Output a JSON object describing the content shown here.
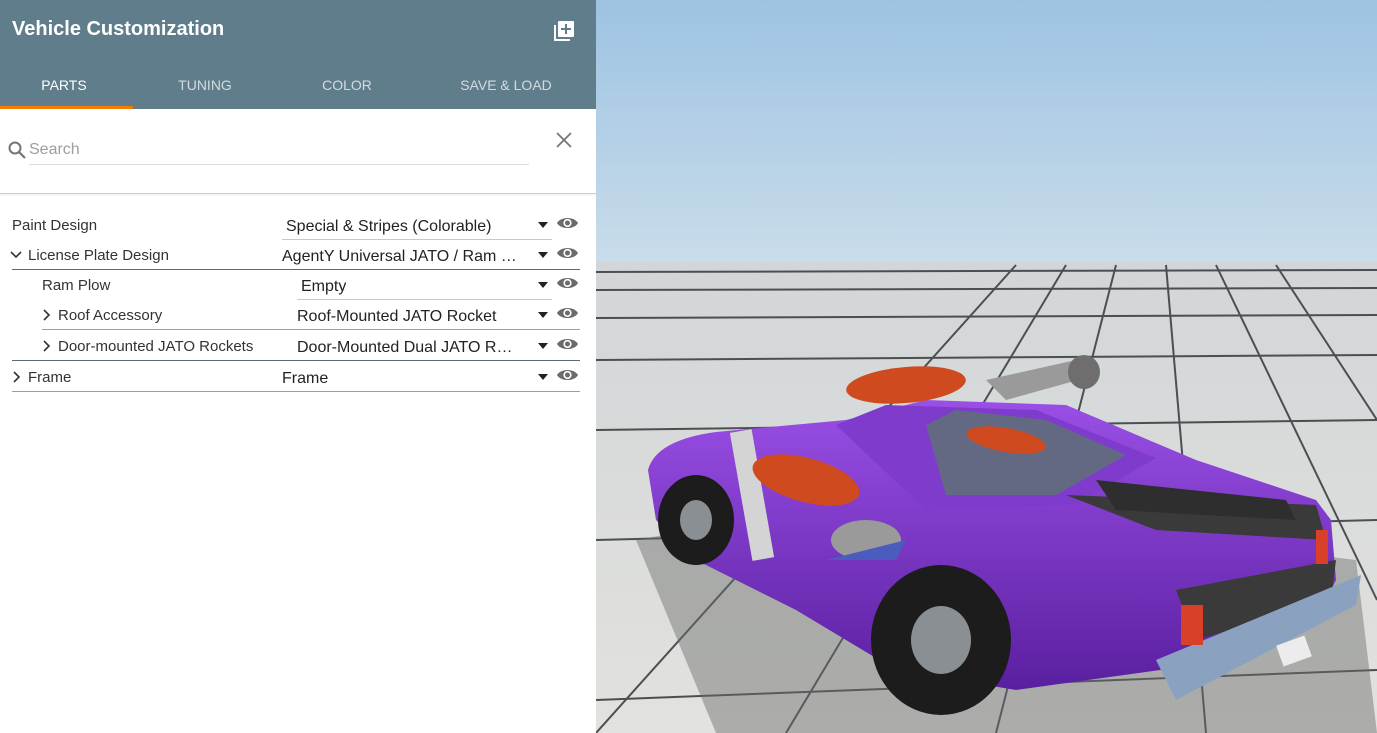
{
  "header": {
    "title": "Vehicle Customization",
    "add_icon": "library-add-icon"
  },
  "tabs": [
    {
      "label": "PARTS",
      "active": true
    },
    {
      "label": "TUNING",
      "active": false
    },
    {
      "label": "COLOR",
      "active": false
    },
    {
      "label": "SAVE & LOAD",
      "active": false
    }
  ],
  "search": {
    "placeholder": "Search",
    "value": ""
  },
  "parts": [
    {
      "label": "Paint Design",
      "value": "Special & Stripes (Colorable)",
      "expander": "none"
    },
    {
      "label": "License Plate Design",
      "value": "AgentY Universal JATO / Ram Plow",
      "expander": "expanded"
    },
    {
      "label": "Ram Plow",
      "value": "Empty",
      "expander": "none"
    },
    {
      "label": "Roof Accessory",
      "value": "Roof-Mounted JATO Rocket",
      "expander": "collapsed"
    },
    {
      "label": "Door-mounted JATO Rockets",
      "value": "Door-Mounted Dual JATO Rockets",
      "expander": "collapsed"
    },
    {
      "label": "Frame",
      "value": "Frame",
      "expander": "collapsed"
    }
  ],
  "colors": {
    "header_bg": "#607d8b",
    "tab_indicator": "#f57c00",
    "car_body": "#7b2fc9",
    "sky": "#9cc4e2"
  }
}
